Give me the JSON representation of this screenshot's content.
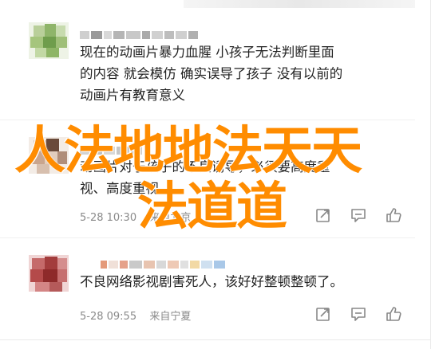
{
  "comments": [
    {
      "text": "现在的动画片暴力血腥 小孩子无法判断里面的内容 就会模仿 确实误导了孩子 没有以前的动画片有教育意义",
      "line1": "现在的动画片暴力血腥 小孩子无法判断里面",
      "line2": "的内容 就会模仿 确实误导了孩子 没有以前的",
      "line3": "动画片有教育意义"
    },
    {
      "line1": "动画片对于孩子的不良诱导，必须要高度重",
      "line2": "视、高度重视",
      "date": "5-28 10:30",
      "location": "来自北京"
    },
    {
      "line1": "不良网络影视剧害死人，该好好整顿整顿了。",
      "date": "5-28 09:55",
      "location": "来自宁夏"
    }
  ],
  "overlay": {
    "line1": "人法地地法天天",
    "line2": "法道道"
  },
  "icons": {
    "share": "share-icon",
    "comment": "comment-icon",
    "like": "thumbs-up-icon"
  },
  "colors": {
    "overlay": "#ff8c00",
    "meta": "#8a8a8a",
    "text": "#222222"
  }
}
